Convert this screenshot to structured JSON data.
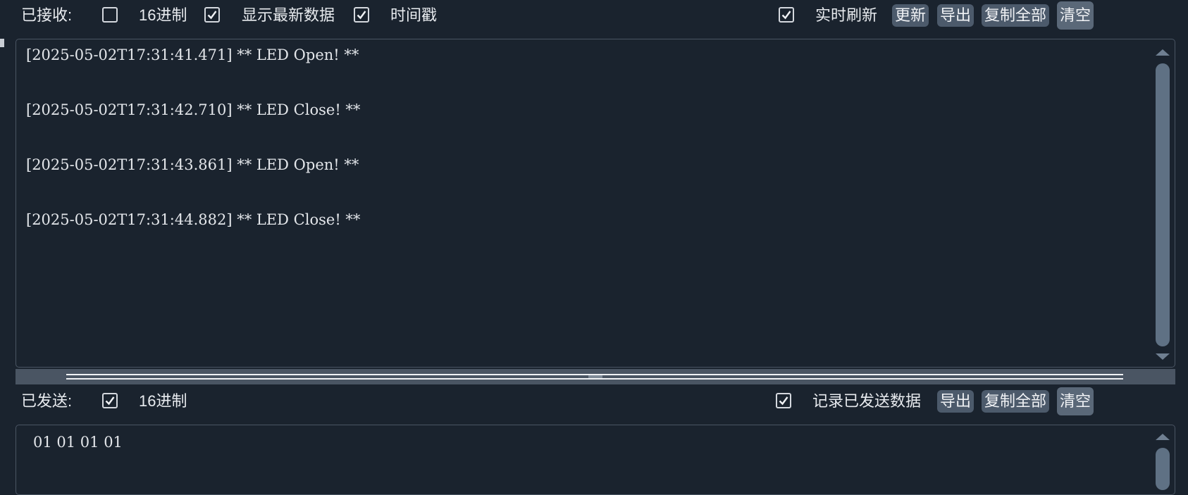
{
  "received": {
    "label": "已接收:",
    "options": {
      "hex": {
        "label": "16进制",
        "checked": false
      },
      "show_latest": {
        "label": "显示最新数据",
        "checked": true
      },
      "timestamp": {
        "label": "时间戳",
        "checked": true
      },
      "realtime_refresh": {
        "label": "实时刷新",
        "checked": true
      }
    },
    "buttons": {
      "update": "更新",
      "export": "导出",
      "copy_all": "复制全部",
      "clear": "清空"
    },
    "lines": [
      "[2025-05-02T17:31:41.471] ** LED Open! **",
      "[2025-05-02T17:31:42.710] ** LED Close! **",
      "[2025-05-02T17:31:43.861] ** LED Open! **",
      "[2025-05-02T17:31:44.882] ** LED Close! **"
    ]
  },
  "sent": {
    "label": "已发送:",
    "options": {
      "hex": {
        "label": "16进制",
        "checked": true
      },
      "record_sent": {
        "label": "记录已发送数据",
        "checked": true
      }
    },
    "buttons": {
      "export": "导出",
      "copy_all": "复制全部",
      "clear": "清空"
    },
    "content": "01 01 01 01"
  },
  "colors": {
    "background": "#1a232e",
    "button": "#4c5a6b",
    "scroll_thumb": "#5f7184"
  },
  "icons": [
    "checkbox-checked-icon",
    "checkbox-empty-icon",
    "scroll-up-arrow-icon",
    "scroll-down-arrow-icon"
  ]
}
